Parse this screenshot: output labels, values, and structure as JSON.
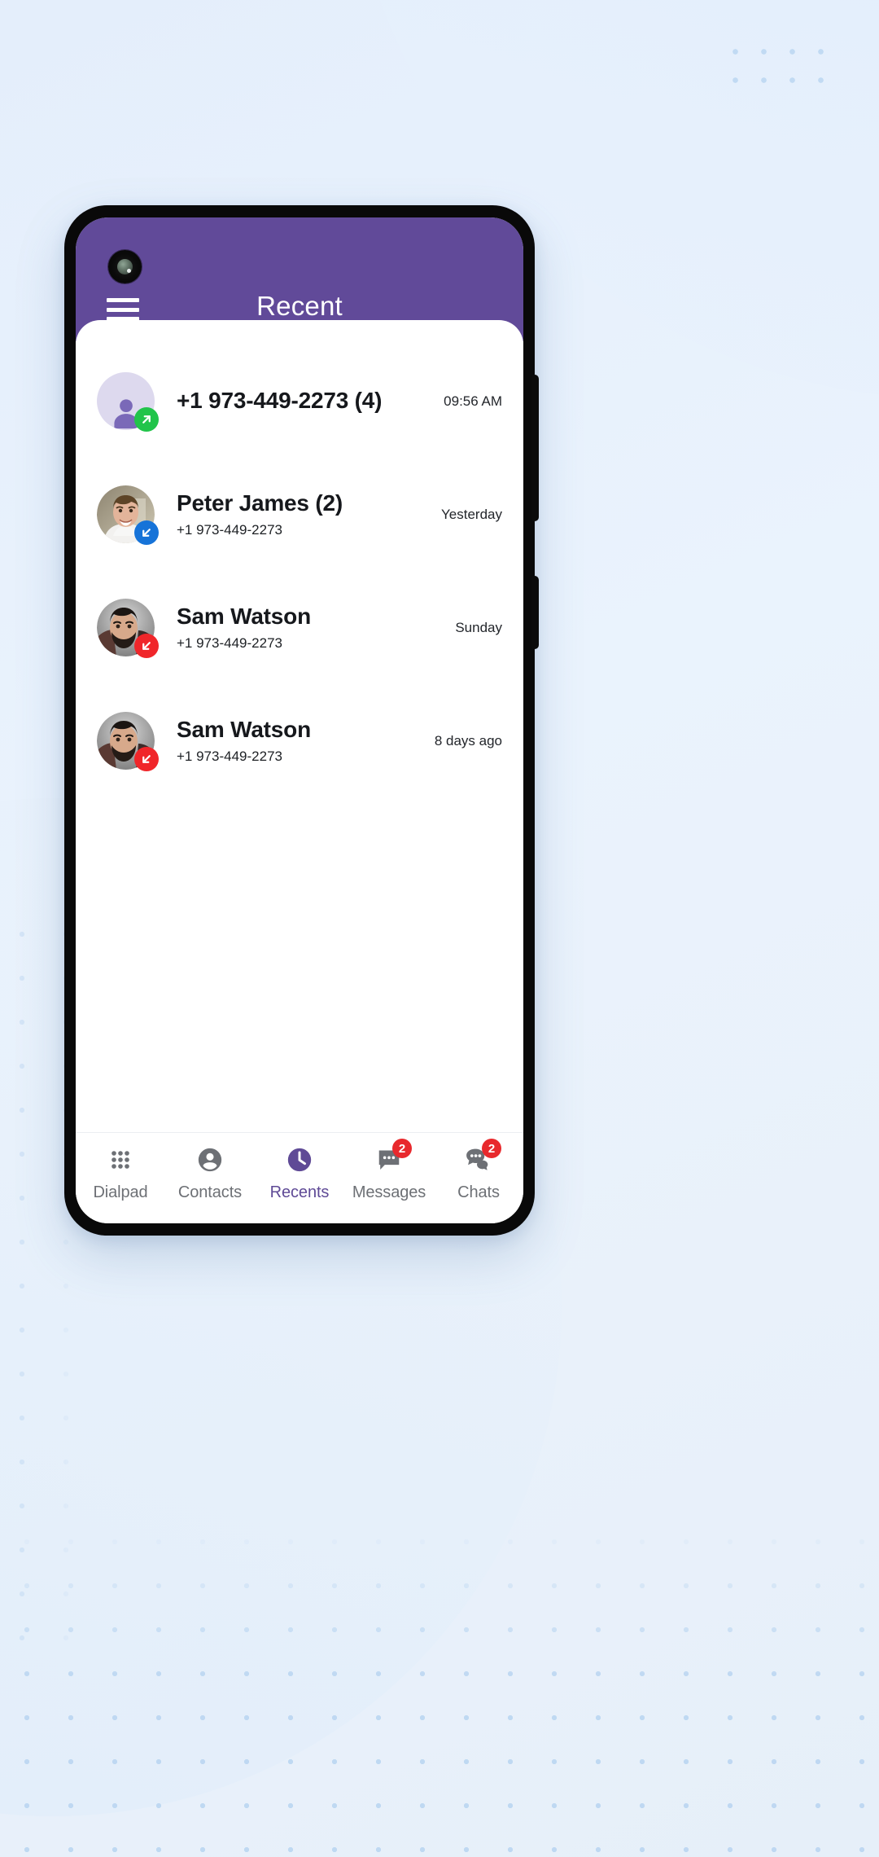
{
  "app": {
    "header": {
      "title": "Recent",
      "menu_icon": "hamburger-menu-icon",
      "accent_color": "#614a99"
    }
  },
  "recents": {
    "calls": [
      {
        "title": "+1 973-449-2273 (4)",
        "subtitle": "",
        "time": "09:56 AM",
        "call_type": "outgoing",
        "badge_icon": "arrow-up-right-icon",
        "badge_color": "#21c44a",
        "avatar_type": "placeholder"
      },
      {
        "title": "Peter James (2)",
        "subtitle": "+1 973-449-2273",
        "time": "Yesterday",
        "call_type": "incoming",
        "badge_icon": "arrow-down-left-icon",
        "badge_color": "#1673d8",
        "avatar_type": "photo-man-smiling"
      },
      {
        "title": "Sam Watson",
        "subtitle": "+1 973-449-2273",
        "time": "Sunday",
        "call_type": "missed",
        "badge_icon": "arrow-down-left-missed-icon",
        "badge_color": "#f0262a",
        "avatar_type": "photo-bearded-man"
      },
      {
        "title": "Sam Watson",
        "subtitle": "+1 973-449-2273",
        "time": "8 days ago",
        "call_type": "missed",
        "badge_icon": "arrow-down-left-missed-icon",
        "badge_color": "#f0262a",
        "avatar_type": "photo-bearded-man"
      }
    ]
  },
  "bottom_nav": {
    "active_color": "#5f4a96",
    "inactive_color": "#6d7075",
    "badge_color": "#e8292d",
    "items": [
      {
        "label": "Dialpad",
        "icon": "dialpad-grid-icon",
        "active": false,
        "badge": ""
      },
      {
        "label": "Contacts",
        "icon": "person-circle-icon",
        "active": false,
        "badge": ""
      },
      {
        "label": "Recents",
        "icon": "clock-icon",
        "active": true,
        "badge": ""
      },
      {
        "label": "Messages",
        "icon": "message-bubble-icon",
        "active": false,
        "badge": "2"
      },
      {
        "label": "Chats",
        "icon": "chat-bubbles-icon",
        "active": false,
        "badge": "2"
      }
    ]
  }
}
